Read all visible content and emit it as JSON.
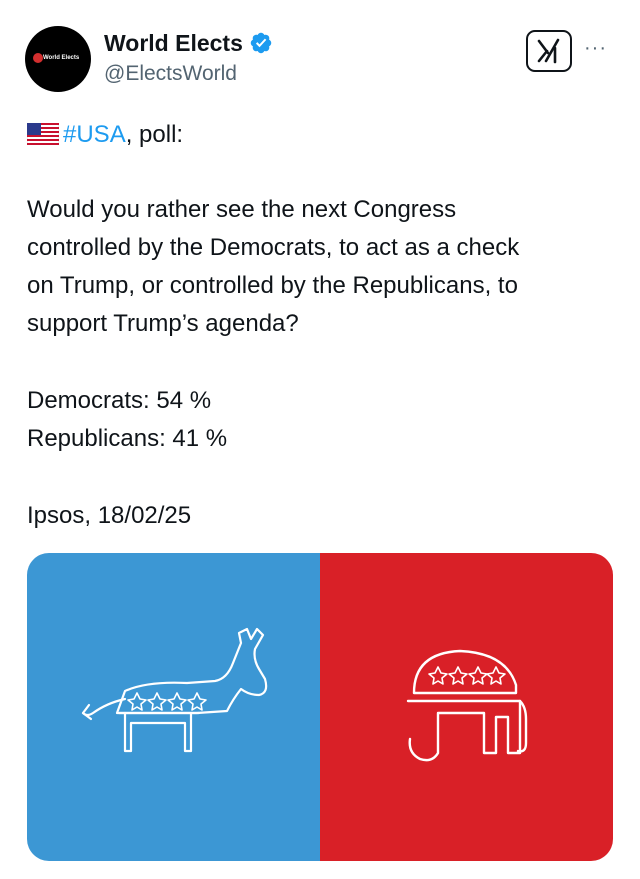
{
  "author": {
    "display_name": "World Elects",
    "handle": "@ElectsWorld",
    "avatar_text": "World Elects",
    "verified": true
  },
  "actions": {
    "grok_icon": "grok-icon",
    "more_label": "···"
  },
  "tweet": {
    "hashtag": "#USA",
    "intro_suffix": ", poll:",
    "question_lines": [
      "Would you rather see the next Congress",
      "controlled by the Democrats, to act as a check",
      "on Trump, or controlled by the Republicans, to",
      "support Trump’s agenda?"
    ],
    "results": [
      {
        "label": "Democrats: 54 %"
      },
      {
        "label": "Republicans: 41 %"
      }
    ],
    "source": "Ipsos, 18/02/25"
  },
  "media": {
    "left_color": "#3c97d4",
    "right_color": "#d92027",
    "left_icon": "democrat-donkey-icon",
    "right_icon": "republican-elephant-icon"
  }
}
